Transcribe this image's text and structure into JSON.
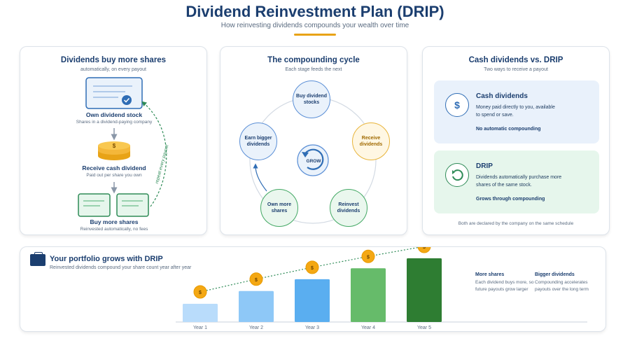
{
  "header": {
    "title": "Dividend Reinvestment Plan (DRIP)",
    "subtitle": "How reinvesting dividends compounds your wealth over time"
  },
  "flow": {
    "title": "Dividends buy more shares",
    "subtitle": "automatically, on every payout",
    "step1_title": "Own dividend stock",
    "step1_sub": "Shares in a dividend-paying company",
    "step2_title": "Receive cash dividend",
    "step2_sub": "Paid out per share you own",
    "step3_title": "Buy more shares",
    "step3_sub": "Reinvested automatically, no fees",
    "loop_label": "repeat every payout",
    "coin_symbol": "$"
  },
  "cycle": {
    "title": "The compounding cycle",
    "subtitle": "Each stage feeds the next",
    "center_label": "GROW",
    "nodes": [
      {
        "label": "Buy dividend stocks",
        "style": "blue"
      },
      {
        "label": "Receive dividends",
        "style": "yellow"
      },
      {
        "label": "Reinvest dividends",
        "style": "green"
      },
      {
        "label": "Own more shares",
        "style": "green"
      },
      {
        "label": "Earn bigger dividends",
        "style": "blue"
      }
    ]
  },
  "compare": {
    "title": "Cash dividends vs. DRIP",
    "subtitle": "Two ways to receive a payout",
    "cash": {
      "icon": "$",
      "title": "Cash dividends",
      "desc": "Money paid directly to you, available to spend or save.",
      "tag": "No automatic compounding"
    },
    "drip": {
      "title": "DRIP",
      "desc": "Dividends automatically purchase more shares of the same stock.",
      "tag": "Grows through compounding"
    },
    "footer": "Both are declared by the company on the same schedule"
  },
  "growth": {
    "title": "Your portfolio grows with DRIP",
    "subtitle": "Reinvested dividends compound your share count year after year",
    "note1_title": "More shares",
    "note1_desc": "Each dividend buys more, so future payouts grow larger",
    "note2_title": "Bigger dividends",
    "note2_desc": "Compounding accelerates payouts over the long term",
    "coin_symbol": "$"
  },
  "chart_data": {
    "type": "bar",
    "categories": [
      "Year 1",
      "Year 2",
      "Year 3",
      "Year 4",
      "Year 5"
    ],
    "values": [
      1,
      1.7,
      2.35,
      2.95,
      3.5
    ],
    "bar_colors": [
      "#b9dcfb",
      "#8ec8f7",
      "#5aaef0",
      "#66bb6a",
      "#2e7d32"
    ]
  },
  "colors": {
    "navy": "#1b3e6f",
    "accent": "#e8a317",
    "blue": "#2f6db5",
    "green": "#2e8b57"
  }
}
